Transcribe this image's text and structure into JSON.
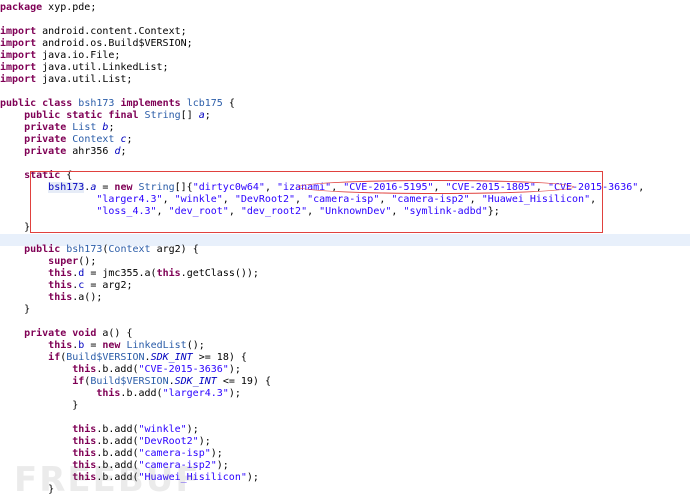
{
  "code": {
    "l01_package": "package",
    "l01_name": " xyp.pde;",
    "import_kw": "import",
    "l03_rest": " android.content.Context;",
    "l04_rest": " android.os.Build$VERSION;",
    "l05_rest": " java.io.File;",
    "l06_rest": " java.util.LinkedList;",
    "l07_rest": " java.util.List;",
    "l09_public": "public",
    "l09_class": "class",
    "l09_name": "bsh173",
    "l09_implements": "implements",
    "l09_iface": "lcb175",
    "l09_brace": " {",
    "l10_public": "public",
    "l10_static": "static",
    "l10_final": "final",
    "l10_type": "String",
    "l10_rest": "[] ",
    "l10_var": "a",
    "l11_private": "private",
    "l11_type": "List",
    "l11_var": "b",
    "l12_private": "private",
    "l12_type": "Context",
    "l12_var": "c",
    "l13_private": "private",
    "l13_type": "ahr356",
    "l13_var": "d",
    "semi": ";",
    "l15_static": "static",
    "l15_brace": " {",
    "l16_cls": "bsh173",
    "l16_dot": ".",
    "l16_field": "a",
    "l16_eq": " = ",
    "l16_new": "new",
    "l16_type": "String",
    "l16_open": "[]{",
    "comma": ", ",
    "s_dirtyc0w64": "\"dirtyc0w64\"",
    "s_izanami": "\"izanami\"",
    "s_cve5195": "\"CVE-2016-5195\"",
    "s_cve1805": "\"CVE-2015-1805\"",
    "s_cve3636": "\"CVE-2015-3636\"",
    "s_larger43": "\"larger4.3\"",
    "s_winkle": "\"winkle\"",
    "s_devroot2": "\"DevRoot2\"",
    "s_camisp": "\"camera-isp\"",
    "s_camisp2": "\"camera-isp2\"",
    "s_hisilicon": "\"Huawei_Hisilicon\"",
    "s_loss43": "\"loss_4.3\"",
    "s_devroot": "\"dev_root\"",
    "s_devroot2b": "\"dev_root2\"",
    "s_unknowndev": "\"UnknownDev\"",
    "s_symlink": "\"symlink-adbd\"",
    "l18_end": "};",
    "close_brace": "}",
    "l21_public": "public",
    "l21_name": "bsh173",
    "l21_type": "Context",
    "l21_rest": " arg2) {",
    "l22_super": "super",
    "l22_rest": "();",
    "this_kw": "this",
    "l23_field": "d",
    "l23_rest": " = jmc355.a(",
    "l23_rest2": ".getClass());",
    "l24_field": "c",
    "l24_rest": " = arg2;",
    "l25_rest": ".a();",
    "l28_private": "private",
    "l28_void": "void",
    "l28_rest": " a() {",
    "l29_field": "b",
    "l29_eq": " = ",
    "l29_new": "new",
    "l29_type": "LinkedList",
    "l29_rest": "();",
    "if_kw": "if",
    "build_type": "Build$VERSION",
    "sdk_int": "SDK_INT",
    "l30_rest": " >= 18) {",
    "b_add": ".b.add(",
    "add_end": ");",
    "l32_rest": " <= 19) {",
    "open_paren": "(",
    "dot": "."
  },
  "watermark": "FREEBUF"
}
